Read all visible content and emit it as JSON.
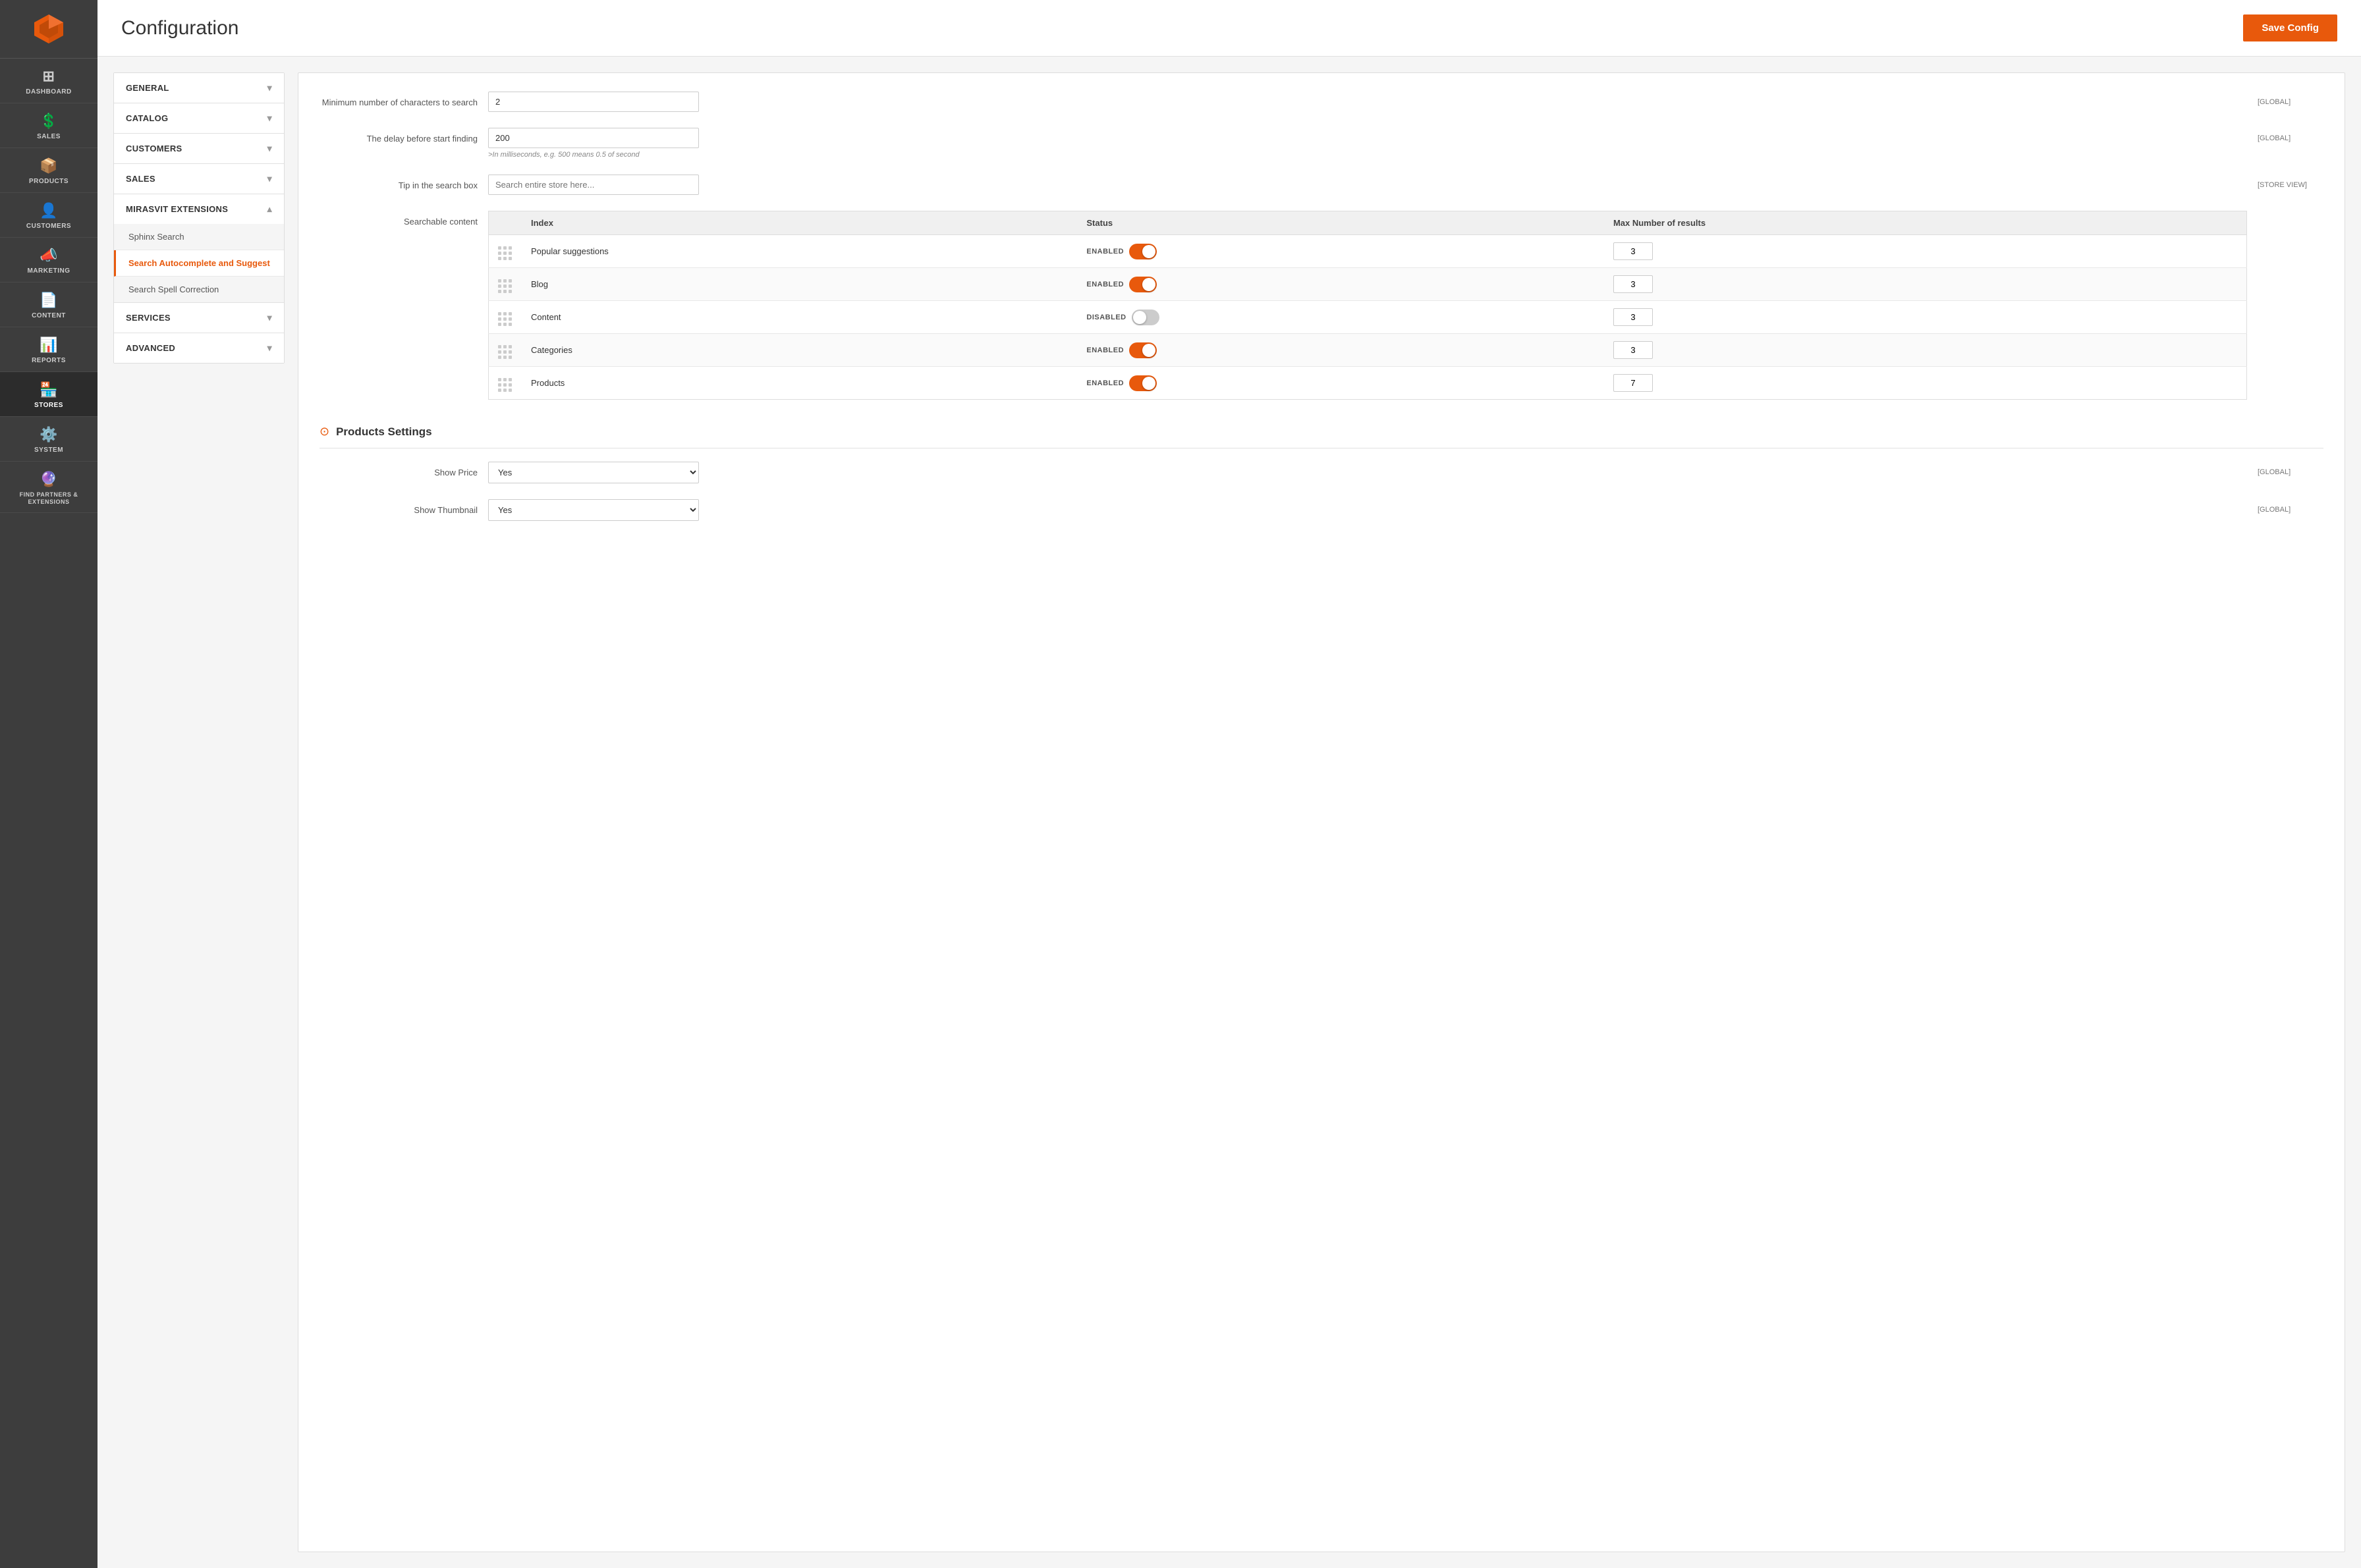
{
  "header": {
    "title": "Configuration",
    "save_button": "Save Config"
  },
  "sidebar": {
    "items": [
      {
        "id": "dashboard",
        "label": "DASHBOARD",
        "icon": "⊞"
      },
      {
        "id": "sales",
        "label": "SALES",
        "icon": "$"
      },
      {
        "id": "products",
        "label": "PRODUCTS",
        "icon": "📦"
      },
      {
        "id": "customers",
        "label": "CUSTOMERS",
        "icon": "👤"
      },
      {
        "id": "marketing",
        "label": "MARKETING",
        "icon": "📣"
      },
      {
        "id": "content",
        "label": "CONTENT",
        "icon": "📄"
      },
      {
        "id": "reports",
        "label": "REPORTS",
        "icon": "📊"
      },
      {
        "id": "stores",
        "label": "STORES",
        "icon": "🏪"
      },
      {
        "id": "system",
        "label": "SYSTEM",
        "icon": "⚙"
      },
      {
        "id": "extensions",
        "label": "FIND PARTNERS & EXTENSIONS",
        "icon": "🔮"
      }
    ]
  },
  "config_nav": {
    "sections": [
      {
        "id": "general",
        "label": "GENERAL",
        "expanded": false,
        "items": []
      },
      {
        "id": "catalog",
        "label": "CATALOG",
        "expanded": false,
        "items": []
      },
      {
        "id": "customers",
        "label": "CUSTOMERS",
        "expanded": false,
        "items": []
      },
      {
        "id": "sales",
        "label": "SALES",
        "expanded": false,
        "items": []
      },
      {
        "id": "mirasvit",
        "label": "MIRASVIT EXTENSIONS",
        "expanded": true,
        "items": [
          {
            "id": "sphinx",
            "label": "Sphinx Search",
            "active": false
          },
          {
            "id": "autocomplete",
            "label": "Search Autocomplete and Suggest",
            "active": true
          },
          {
            "id": "spell",
            "label": "Search Spell Correction",
            "active": false
          }
        ]
      },
      {
        "id": "services",
        "label": "SERVICES",
        "expanded": false,
        "items": []
      },
      {
        "id": "advanced",
        "label": "ADVANCED",
        "expanded": false,
        "items": []
      }
    ]
  },
  "config_panel": {
    "min_chars_label": "Minimum number of characters to search",
    "min_chars_value": "2",
    "min_chars_scope": "[GLOBAL]",
    "delay_label": "The delay before start finding",
    "delay_value": "200",
    "delay_hint": ">In milliseconds, e.g. 500 means 0.5 of second",
    "delay_scope": "[GLOBAL]",
    "tip_label": "Tip in the search box",
    "tip_placeholder": "Search entire store here...",
    "tip_scope": "[STORE VIEW]",
    "searchable_label": "Searchable content",
    "searchable_table": {
      "headers": [
        "Index",
        "Status",
        "Max Number of results"
      ],
      "rows": [
        {
          "index": "Popular suggestions",
          "status": "ENABLED",
          "enabled": true,
          "max": "3"
        },
        {
          "index": "Blog",
          "status": "ENABLED",
          "enabled": true,
          "max": "3"
        },
        {
          "index": "Content",
          "status": "DISABLED",
          "enabled": false,
          "max": "3"
        },
        {
          "index": "Categories",
          "status": "ENABLED",
          "enabled": true,
          "max": "3"
        },
        {
          "index": "Products",
          "status": "ENABLED",
          "enabled": true,
          "max": "7"
        }
      ]
    },
    "products_settings": {
      "title": "Products Settings",
      "show_price_label": "Show Price",
      "show_price_value": "Yes",
      "show_price_scope": "[GLOBAL]",
      "show_thumbnail_label": "Show Thumbnail",
      "show_thumbnail_value": "Yes",
      "show_thumbnail_scope": "[GLOBAL]"
    }
  }
}
